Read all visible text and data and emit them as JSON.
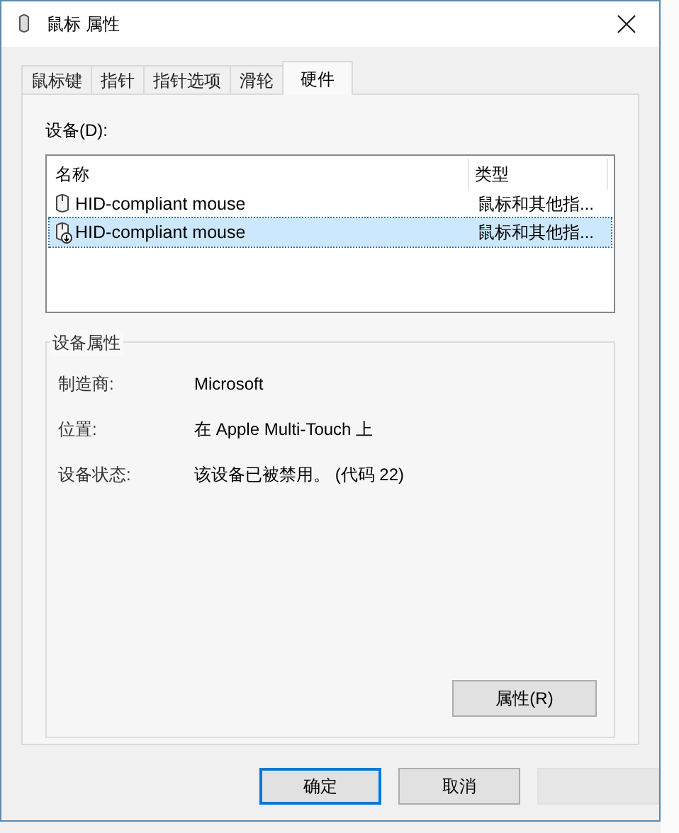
{
  "window": {
    "title": "鼠标 属性"
  },
  "tabs": [
    {
      "label": "鼠标键",
      "selected": false
    },
    {
      "label": "指针",
      "selected": false
    },
    {
      "label": "指针选项",
      "selected": false
    },
    {
      "label": "滑轮",
      "selected": false
    },
    {
      "label": "硬件",
      "selected": true
    }
  ],
  "devices_label": "设备(D):",
  "device_list": {
    "columns": [
      "名称",
      "类型"
    ],
    "rows": [
      {
        "name": "HID-compliant mouse",
        "type": "鼠标和其他指...",
        "selected": false,
        "disabled": false
      },
      {
        "name": "HID-compliant mouse",
        "type": "鼠标和其他指...",
        "selected": true,
        "disabled": true
      }
    ]
  },
  "properties": {
    "title": "设备属性",
    "fields": [
      {
        "label": "制造商:",
        "value": "Microsoft"
      },
      {
        "label": "位置:",
        "value": "在 Apple Multi-Touch 上"
      },
      {
        "label": "设备状态:",
        "value": "该设备已被禁用。 (代码 22)"
      }
    ],
    "button": "属性(R)"
  },
  "buttons": [
    {
      "label": "确定",
      "default": true,
      "disabled": false
    },
    {
      "label": "取消",
      "default": false,
      "disabled": false
    },
    {
      "default": false,
      "disabled": true
    }
  ]
}
